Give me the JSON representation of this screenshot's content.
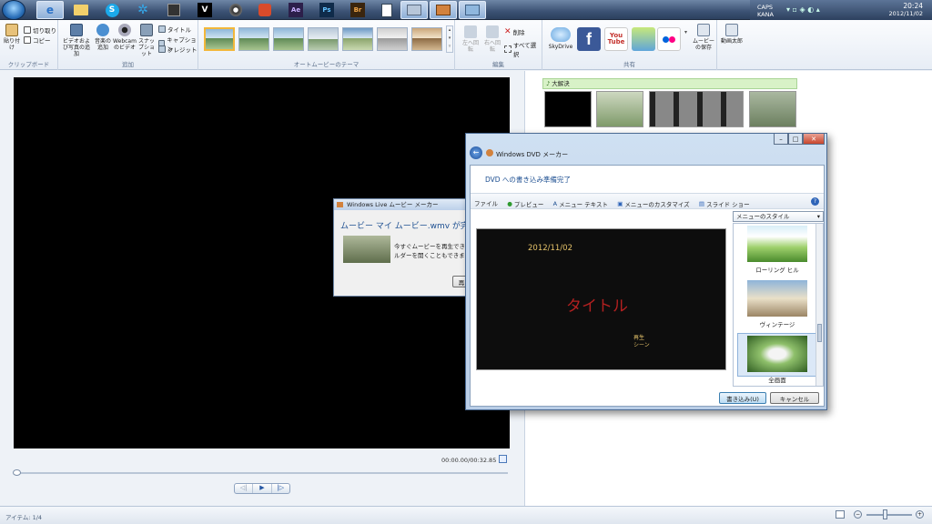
{
  "taskbar": {
    "clock_time": "20:24",
    "clock_date": "2012/11/02",
    "tray_text_1": "CAPS",
    "tray_text_2": "KANA"
  },
  "ribbon": {
    "groups": {
      "clipboard": "クリップボード",
      "add": "追加",
      "themes": "オートムービーのテーマ",
      "edit": "編集",
      "share": "共有"
    },
    "paste": "貼り付け",
    "cut": "切り取り",
    "copy": "コピー",
    "add_video_photo": "ビデオおよび写真の追加",
    "add_music": "音楽の追加",
    "webcam_video": "Webcam のビデオ",
    "snapshot": "スナップショット",
    "title": "タイトル",
    "caption": "キャプション",
    "credits": "クレジット",
    "rotate_left": "左へ回転",
    "rotate_right": "右へ回転",
    "delete": "削除",
    "select_all": "すべて選択",
    "skydrive": "SkyDrive",
    "facebook": "f",
    "youtube": "You Tube",
    "save_movie": "ムービーの保存",
    "taro": "動画太郎"
  },
  "preview": {
    "timecode": "00:00.00/00:32.85"
  },
  "storyboard": {
    "track_label": "大解決"
  },
  "progress_dialog": {
    "title": "Windows Live ムービー メーカー",
    "heading": "ムービー マイ ムービー.wmv が完成",
    "line1": "今すぐムービーを再生でき",
    "line2": "ルダーを開くこともできま",
    "button": "再"
  },
  "dvd": {
    "title": "Windows DVD メーカー",
    "heading": "DVD への書き込み準備完了",
    "toolbar": {
      "file": "ファイル",
      "preview": "プレビュー",
      "menu_text": "メニュー テキスト",
      "customize_menu": "メニューのカスタマイズ",
      "slideshow": "スライド ショー"
    },
    "menu_preview": {
      "date": "2012/11/02",
      "title": "タイトル",
      "play": "再生",
      "scenes": "シーン"
    },
    "styles_label": "メニューのスタイル",
    "styles": [
      {
        "name": "ローリング ヒル"
      },
      {
        "name": "ヴィンテージ"
      },
      {
        "name": "全画面"
      }
    ],
    "burn_button": "書き込み(U)",
    "cancel_button": "キャンセル"
  },
  "status": {
    "items": "アイテム: 1/4"
  }
}
